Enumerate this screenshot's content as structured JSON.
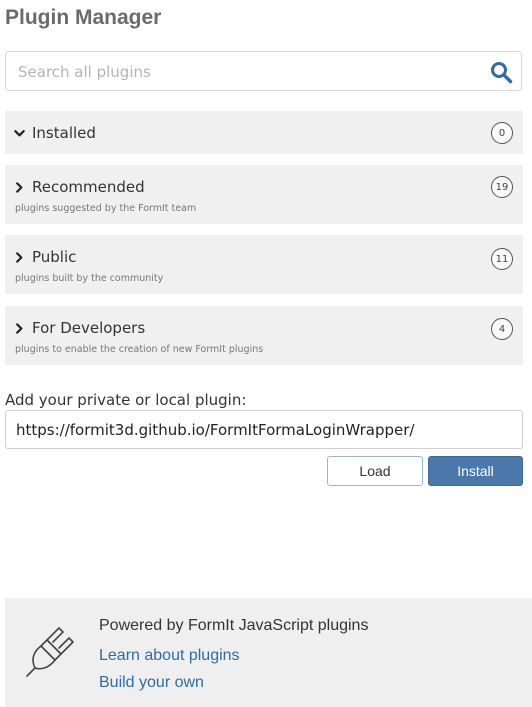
{
  "header": {
    "title": "Plugin Manager"
  },
  "search": {
    "placeholder": "Search all plugins",
    "value": ""
  },
  "sections": [
    {
      "label": "Installed",
      "subtitle": "",
      "count": "0",
      "expanded": true
    },
    {
      "label": "Recommended",
      "subtitle": "plugins suggested by the FormIt team",
      "count": "19",
      "expanded": false
    },
    {
      "label": "Public",
      "subtitle": "plugins built by the community",
      "count": "11",
      "expanded": false
    },
    {
      "label": "For Developers",
      "subtitle": "plugins to enable the creation of new FormIt plugins",
      "count": "4",
      "expanded": false
    }
  ],
  "add_plugin": {
    "label": "Add your private or local plugin:",
    "url_value": "https://formit3d.github.io/FormItFormaLoginWrapper/",
    "load_label": "Load",
    "install_label": "Install"
  },
  "footer": {
    "powered_text": "Powered by FormIt JavaScript plugins",
    "learn_link": "Learn about plugins",
    "build_link": "Build your own"
  },
  "colors": {
    "accent": "#4a78ab",
    "link": "#2e6da4",
    "section_bg": "#f0f0f0",
    "search_icon": "#2e6da4"
  }
}
